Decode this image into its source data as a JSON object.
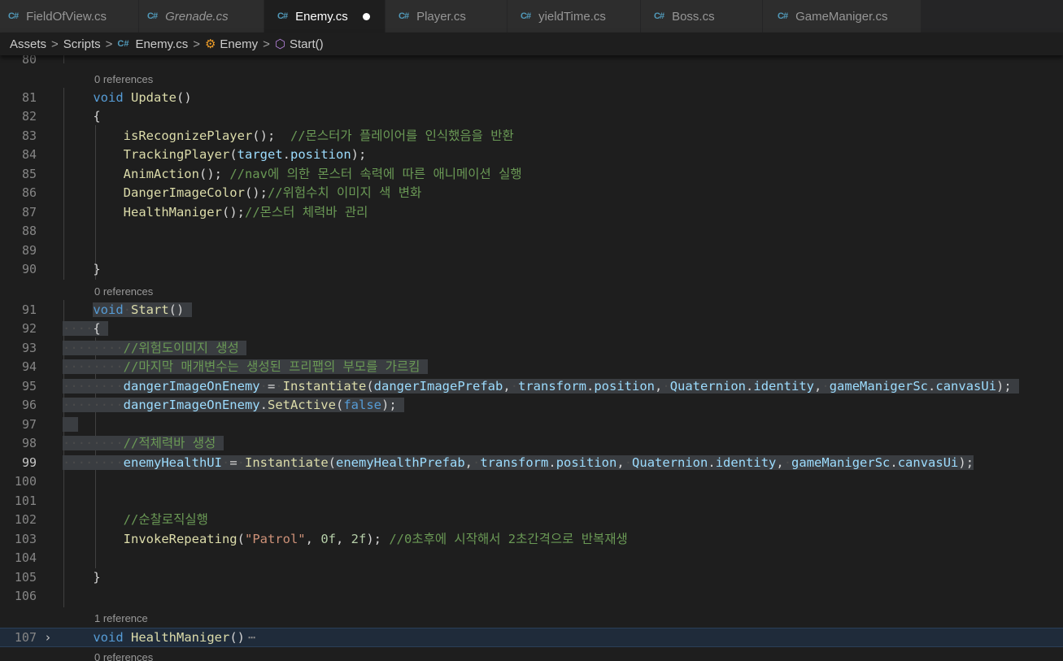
{
  "tabs": [
    {
      "label": "FieldOfView.cs",
      "icon": "csharp-icon",
      "active": false,
      "italic": false
    },
    {
      "label": "Grenade.cs",
      "icon": "csharp-icon",
      "active": false,
      "italic": true
    },
    {
      "label": "Enemy.cs",
      "icon": "csharp-icon",
      "active": true,
      "italic": false,
      "modified": true
    },
    {
      "label": "Player.cs",
      "icon": "csharp-icon",
      "active": false,
      "italic": false
    },
    {
      "label": "yieldTime.cs",
      "icon": "csharp-icon",
      "active": false,
      "italic": false
    },
    {
      "label": "Boss.cs",
      "icon": "csharp-icon",
      "active": false,
      "italic": false
    },
    {
      "label": "GameManiger.cs",
      "icon": "csharp-icon",
      "active": false,
      "italic": false
    }
  ],
  "breadcrumb": {
    "items": [
      "Assets",
      "Scripts",
      "Enemy.cs",
      "Enemy",
      "Start()"
    ],
    "separator": ">",
    "cs_icon_text": "C#"
  },
  "lens": {
    "update": "0 references",
    "start": "0 references",
    "health": "1 reference",
    "next": "0 references"
  },
  "lines": {
    "l80": "80",
    "l81": "81",
    "l82": "82",
    "l83": "83",
    "l84": "84",
    "l85": "85",
    "l86": "86",
    "l87": "87",
    "l88": "88",
    "l89": "89",
    "l90": "90",
    "l91": "91",
    "l92": "92",
    "l93": "93",
    "l94": "94",
    "l95": "95",
    "l96": "96",
    "l97": "97",
    "l98": "98",
    "l99": "99",
    "l100": "100",
    "l101": "101",
    "l102": "102",
    "l103": "103",
    "l104": "104",
    "l105": "105",
    "l106": "106",
    "l107": "107"
  },
  "code": {
    "c83_comment": "//몬스터가 플레이어를 인식했음을 반환",
    "c85_comment": "//nav에 의한 몬스터 속력에 따른 애니메이션 실행",
    "c86_comment": "//위험수치 이미지 색 변화",
    "c87_comment": "//몬스터 체력바 관리",
    "c93_comment": "//위험도이미지 생성",
    "c94_comment": "//마지막 매개변수는 생성된 프리팹의 부모를 가르킴",
    "c98_comment": "//적체력바 생성",
    "c102_comment": "//순찰로직실행",
    "c103_string": "\"Patrol\"",
    "c103_comment": "//0초후에 시작해서 2초간격으로 반복재생",
    "fold_marker": "⋯"
  },
  "colors": {
    "keyword": "#569cd6",
    "function": "#dcdcaa",
    "variable": "#9cdcfe",
    "comment": "#6a9955",
    "string": "#ce9178",
    "number": "#b5cea8",
    "selection": "#3a3d41",
    "cs_icon": "#519aba"
  }
}
